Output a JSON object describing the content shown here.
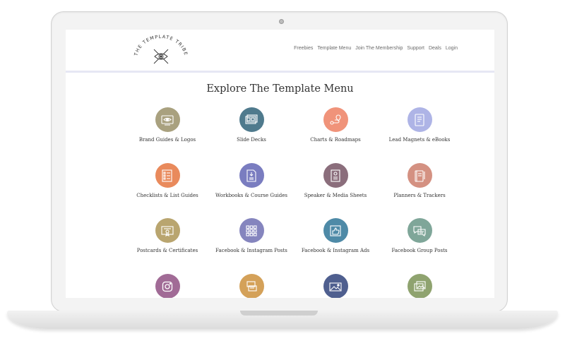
{
  "brand": {
    "logo_text": "THE TEMPLATE TRIBE"
  },
  "nav": {
    "items": [
      "Freebies",
      "Template Menu",
      "Join The Membership",
      "Support",
      "Deals",
      "Login"
    ]
  },
  "page": {
    "title": "Explore The Template Menu"
  },
  "menu": [
    {
      "label": "Brand Guides & Logos",
      "color": "#a9a17f",
      "icon": "eye-card-icon"
    },
    {
      "label": "Slide Decks",
      "color": "#4f7a8d",
      "icon": "slides-icon"
    },
    {
      "label": "Charts & Roadmaps",
      "color": "#f0937a",
      "icon": "roadmap-icon"
    },
    {
      "label": "Lead Magnets & eBooks",
      "color": "#aeb4e6",
      "icon": "ebook-icon"
    },
    {
      "label": "Checklists & List Guides",
      "color": "#e98a5c",
      "icon": "checklist-icon"
    },
    {
      "label": "Workbooks & Course Guides",
      "color": "#7a7dc0",
      "icon": "workbook-icon"
    },
    {
      "label": "Speaker & Media Sheets",
      "color": "#8b6e7c",
      "icon": "speaker-sheet-icon"
    },
    {
      "label": "Planners & Trackers",
      "color": "#d49182",
      "icon": "planner-icon"
    },
    {
      "label": "Postcards & Certificates",
      "color": "#b9a56f",
      "icon": "certificate-icon"
    },
    {
      "label": "Facebook & Instagram Posts",
      "color": "#8585be",
      "icon": "grid-posts-icon"
    },
    {
      "label": "Facebook & Instagram Ads",
      "color": "#4e8aa7",
      "icon": "thumbs-up-icon"
    },
    {
      "label": "Facebook Group Posts",
      "color": "#7fa699",
      "icon": "chat-bubbles-icon"
    },
    {
      "label": "",
      "color": "#a16b96",
      "icon": "instagram-icon"
    },
    {
      "label": "",
      "color": "#d4a159",
      "icon": "stacked-posts-icon"
    },
    {
      "label": "",
      "color": "#4f5f8f",
      "icon": "image-icon"
    },
    {
      "label": "",
      "color": "#8fa36f",
      "icon": "photo-collage-icon"
    }
  ]
}
